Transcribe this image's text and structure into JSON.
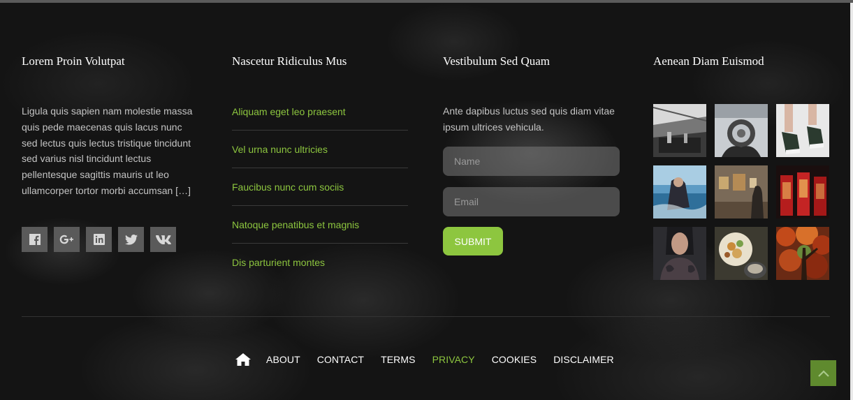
{
  "widgets": {
    "about": {
      "title": "Lorem Proin Volutpat",
      "text": "Ligula quis sapien nam molestie massa quis pede maecenas quis lacus nunc sed lectus quis lectus tristique tincidunt sed varius nisl tincidunt lectus pellentesque sagittis mauris ut leo ullamcorper tortor morbi accumsan […]",
      "social_icons": [
        "facebook-icon",
        "google-plus-icon",
        "linkedin-icon",
        "twitter-icon",
        "vk-icon"
      ]
    },
    "links": {
      "title": "Nascetur Ridiculus Mus",
      "items": [
        "Aliquam eget leo praesent",
        "Vel urna nunc ultricies",
        "Faucibus nunc cum sociis",
        "Natoque penatibus et magnis",
        "Dis parturient montes"
      ]
    },
    "subscribe": {
      "title": "Vestibulum Sed Quam",
      "text": "Ante dapibus luctus sed quis diam vitae ipsum ultrices vehicula.",
      "name_placeholder": "Name",
      "name_value": "",
      "email_placeholder": "Email",
      "email_value": "",
      "submit_label": "Submit"
    },
    "gallery": {
      "title": "Aenean Diam Euismod",
      "images": [
        "concert-stage",
        "lens-in-hand",
        "sneakers-feet",
        "woman-by-sea",
        "art-gallery",
        "red-phone-booths",
        "tattooed-woman",
        "food-plate",
        "autumn-tree"
      ]
    }
  },
  "footer_nav": {
    "home_icon": "home-icon",
    "items": [
      "About",
      "Contact",
      "Terms",
      "Privacy",
      "Cookies",
      "Disclaimer"
    ],
    "active": "Privacy"
  },
  "colors": {
    "accent": "#8dc63f",
    "to_top": "#5f8a2e",
    "background": "#151515"
  }
}
